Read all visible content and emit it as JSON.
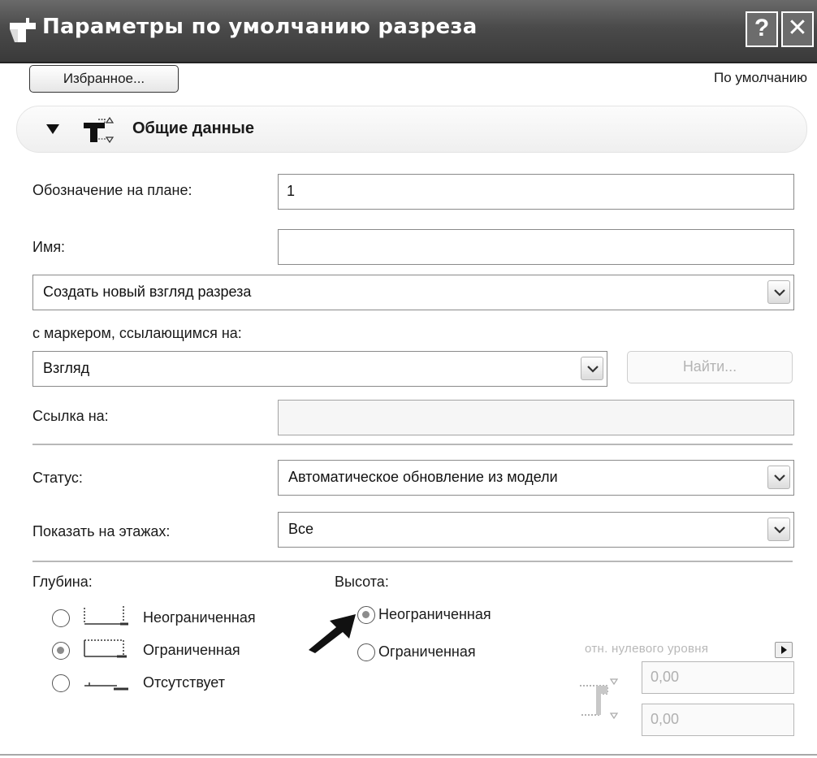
{
  "window": {
    "title": "Параметры по умолчанию разреза",
    "help_label": "?",
    "close_label": "✕"
  },
  "toolbar": {
    "favorites_label": "Избранное...",
    "default_label": "По умолчанию"
  },
  "section": {
    "title": "Общие данные",
    "icon": "section-marker-icon"
  },
  "fields": {
    "plan_id_label": "Обозначение на плане:",
    "plan_id_value": "1",
    "name_label": "Имя:",
    "name_value": "",
    "view_mode_value": "Создать новый взгляд разреза",
    "marker_ref_label": "с маркером, ссылающимся на:",
    "marker_ref_value": "Взгляд",
    "find_label": "Найти...",
    "link_label": "Ссылка на:",
    "link_value": "",
    "status_label": "Статус:",
    "status_value": "Автоматическое обновление из модели",
    "stories_label": "Показать на этажах:",
    "stories_value": "Все"
  },
  "depth": {
    "label": "Глубина:",
    "options": [
      {
        "label": "Неограниченная",
        "checked": false
      },
      {
        "label": "Ограниченная",
        "checked": true
      },
      {
        "label": "Отсутствует",
        "checked": false
      }
    ]
  },
  "height": {
    "label": "Высота:",
    "options": [
      {
        "label": "Неограниченная",
        "checked": true
      },
      {
        "label": "Ограниченная",
        "checked": false
      }
    ],
    "relative_label": "отн. нулевого уровня",
    "top_value": "0,00",
    "bottom_value": "0,00"
  },
  "colors": {
    "titlebar": "#4a4a4a",
    "text": "#1a1a1a",
    "disabled_text": "#b4b4b4"
  }
}
